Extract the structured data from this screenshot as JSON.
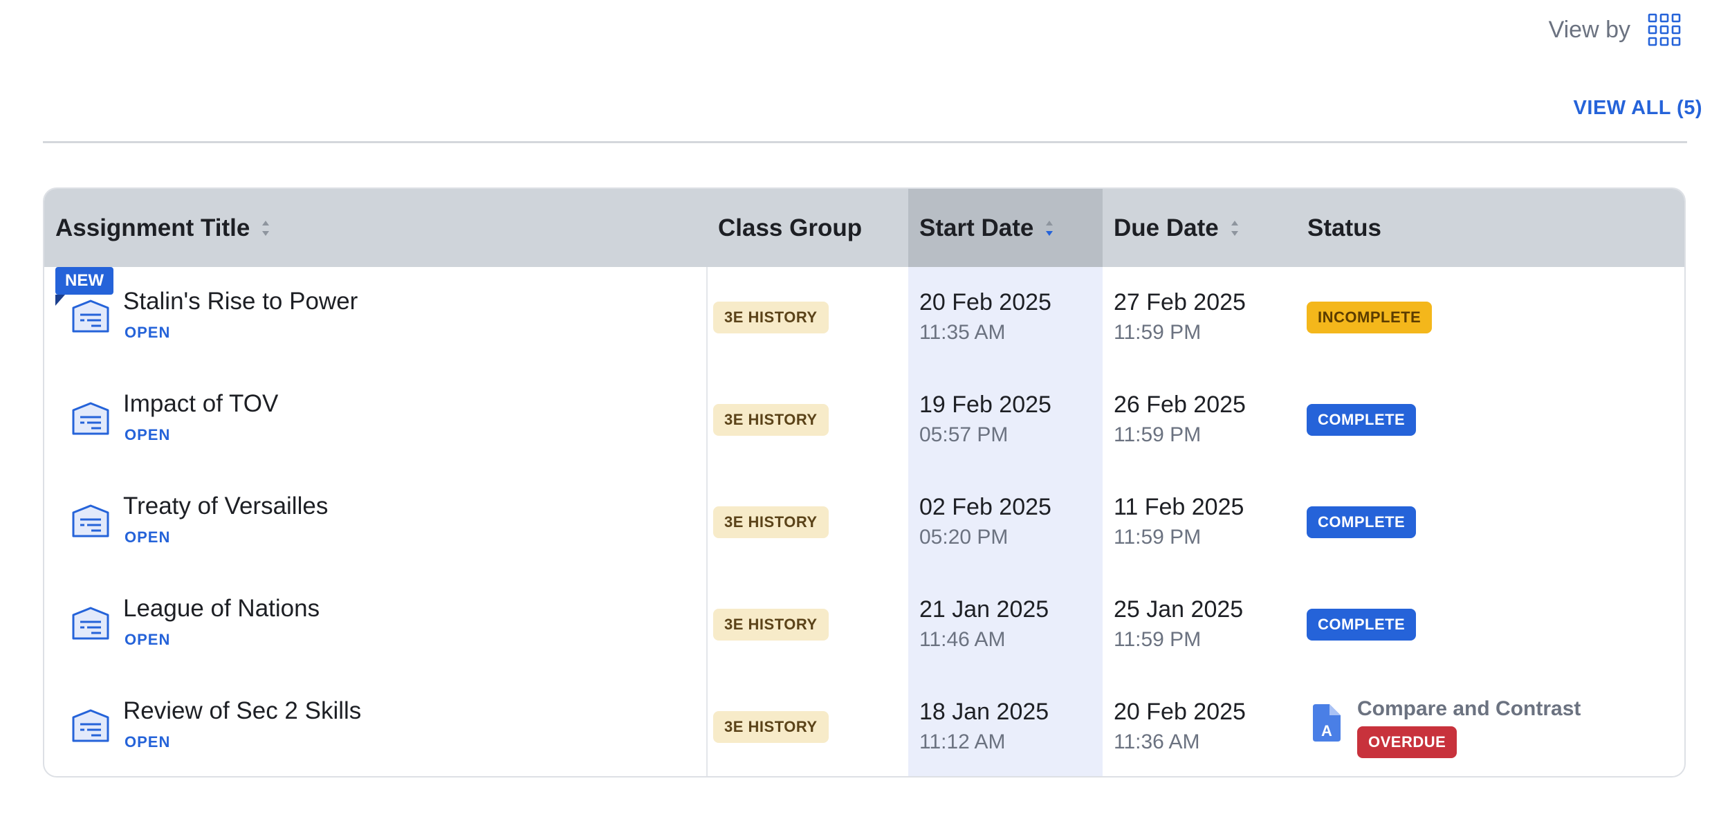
{
  "toolbar": {
    "view_by_label": "View by",
    "view_icon": "grid-icon",
    "view_all_label": "VIEW ALL (5)"
  },
  "table": {
    "headers": {
      "assignment_title": "Assignment Title",
      "class_group": "Class Group",
      "start_date": "Start Date",
      "due_date": "Due Date",
      "status": "Status"
    },
    "sorted_by": "Start Date",
    "sort_direction": "descending",
    "rows": [
      {
        "badge": "NEW",
        "title": "Stalin's Rise to Power",
        "link": "OPEN",
        "class_group": "3E HISTORY",
        "start_date": "20 Feb 2025",
        "start_time": "11:35 AM",
        "due_date": "27 Feb 2025",
        "due_time": "11:59 PM",
        "status": "INCOMPLETE"
      },
      {
        "title": "Impact of TOV",
        "link": "OPEN",
        "class_group": "3E HISTORY",
        "start_date": "19 Feb 2025",
        "start_time": "05:57 PM",
        "due_date": "26 Feb 2025",
        "due_time": "11:59 PM",
        "status": "COMPLETE"
      },
      {
        "title": "Treaty of Versailles",
        "link": "OPEN",
        "class_group": "3E HISTORY",
        "start_date": "02 Feb 2025",
        "start_time": "05:20 PM",
        "due_date": "11 Feb 2025",
        "due_time": "11:59 PM",
        "status": "COMPLETE"
      },
      {
        "title": "League of Nations",
        "link": "OPEN",
        "class_group": "3E HISTORY",
        "start_date": "21 Jan 2025",
        "start_time": "11:46 AM",
        "due_date": "25 Jan 2025",
        "due_time": "11:59 PM",
        "status": "COMPLETE"
      },
      {
        "title": "Review of Sec 2 Skills",
        "link": "OPEN",
        "class_group": "3E HISTORY",
        "start_date": "18 Jan 2025",
        "start_time": "11:12 AM",
        "due_date": "20 Feb 2025",
        "due_time": "11:36 AM",
        "status": "OVERDUE",
        "linked_item": {
          "icon": "document-a-icon",
          "icon_letter": "A",
          "title": "Compare and Contrast"
        }
      }
    ]
  },
  "colors": {
    "accent": "#2563d9",
    "incomplete": "#f4b71b",
    "overdue": "#c8323c",
    "class_badge": "#f7ebc9",
    "header_bg": "#cfd4da",
    "sorted_col_bg": "#eaeefb"
  }
}
